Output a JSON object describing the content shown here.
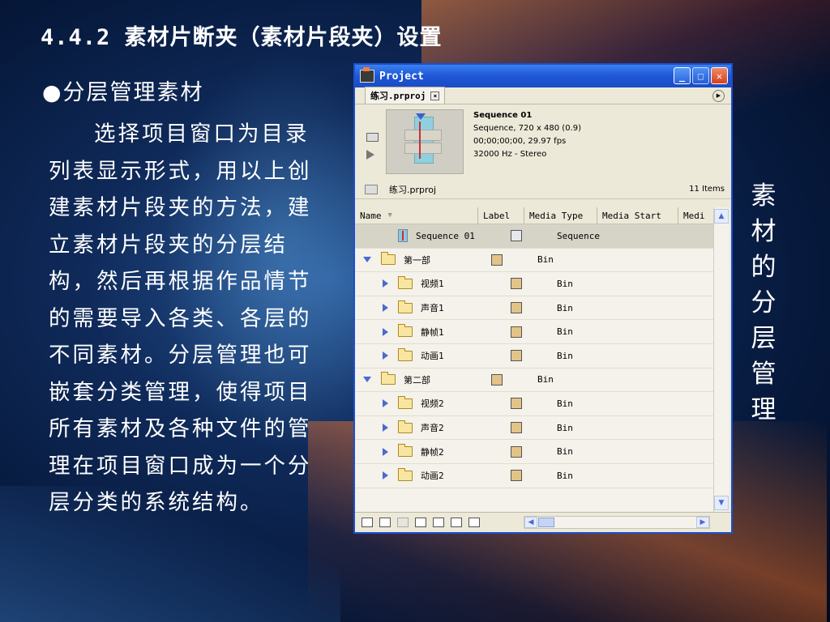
{
  "slide": {
    "title": "4.4.2 素材片断夹（素材片段夹）设置",
    "bullet": "●分层管理素材",
    "paragraph": "选择项目窗口为目录列表显示形式，用以上创建素材片段夹的方法，建立素材片段夹的分层结构，然后再根据作品情节的需要导入各类、各层的不同素材。分层管理也可嵌套分类管理，使得项目所有素材及各种文件的管理在项目窗口成为一个分层分类的系统结构。",
    "side_vertical": [
      "素",
      "材",
      "的",
      "分",
      "层",
      "管",
      "理"
    ]
  },
  "window": {
    "title": "Project",
    "tab_label": "练习.prproj",
    "preview": {
      "name": "Sequence 01",
      "line1": "Sequence, 720 x 480 (0.9)",
      "line2": "00;00;00;00, 29.97 fps",
      "line3": "32000 Hz - Stereo"
    },
    "path": "练习.prproj",
    "item_count": "11 Items",
    "columns": {
      "name": "Name",
      "label": "Label",
      "media_type": "Media Type",
      "media_start": "Media Start",
      "media_more": "Medi"
    },
    "rows": [
      {
        "name": "Sequence 01",
        "type": "Sequence",
        "icon": "sequence-icon",
        "indent": 1,
        "toggle": "none",
        "label_color": "#e6e8ee"
      },
      {
        "name": "第一部",
        "type": "Bin",
        "icon": "folder-icon",
        "indent": 0,
        "toggle": "open",
        "label_color": "#e2c488"
      },
      {
        "name": "视频1",
        "type": "Bin",
        "icon": "folder-icon",
        "indent": 1,
        "toggle": "closed",
        "label_color": "#e2c488"
      },
      {
        "name": "声音1",
        "type": "Bin",
        "icon": "folder-icon",
        "indent": 1,
        "toggle": "closed",
        "label_color": "#e2c488"
      },
      {
        "name": "静帧1",
        "type": "Bin",
        "icon": "folder-icon",
        "indent": 1,
        "toggle": "closed",
        "label_color": "#e2c488"
      },
      {
        "name": "动画1",
        "type": "Bin",
        "icon": "folder-icon",
        "indent": 1,
        "toggle": "closed",
        "label_color": "#e2c488"
      },
      {
        "name": "第二部",
        "type": "Bin",
        "icon": "folder-icon",
        "indent": 0,
        "toggle": "open",
        "label_color": "#e2c488"
      },
      {
        "name": "视频2",
        "type": "Bin",
        "icon": "folder-icon",
        "indent": 1,
        "toggle": "closed",
        "label_color": "#e2c488"
      },
      {
        "name": "声音2",
        "type": "Bin",
        "icon": "folder-icon",
        "indent": 1,
        "toggle": "closed",
        "label_color": "#e2c488"
      },
      {
        "name": "静帧2",
        "type": "Bin",
        "icon": "folder-icon",
        "indent": 1,
        "toggle": "closed",
        "label_color": "#e2c488"
      },
      {
        "name": "动画2",
        "type": "Bin",
        "icon": "folder-icon",
        "indent": 1,
        "toggle": "closed",
        "label_color": "#e2c488"
      }
    ]
  }
}
